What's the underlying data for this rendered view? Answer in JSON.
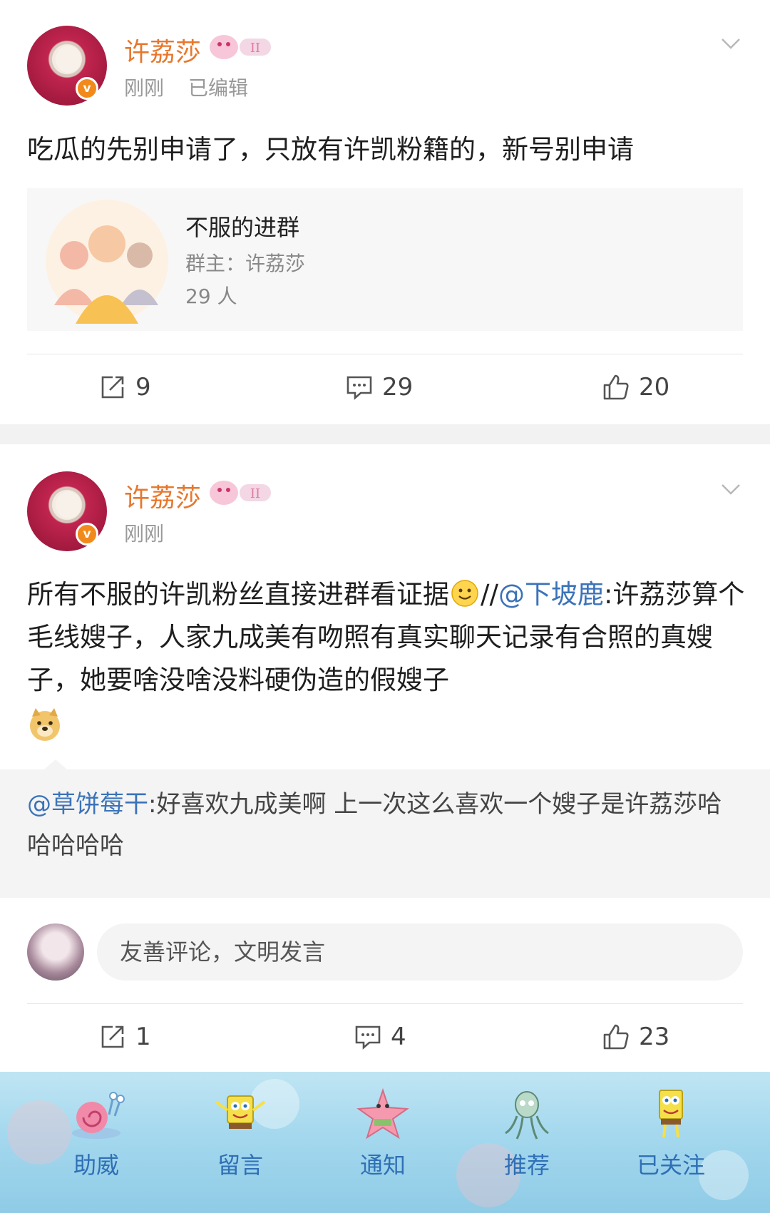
{
  "post1": {
    "username": "许荔莎",
    "time": "刚刚",
    "edited": "已编辑",
    "text": "吃瓜的先别申请了，只放有许凯粉籍的，新号别申请",
    "group_card": {
      "title": "不服的进群",
      "owner": "群主：许荔莎",
      "members": "29 人"
    },
    "actions": {
      "repost": "9",
      "comment": "29",
      "like": "20"
    }
  },
  "post2": {
    "username": "许荔莎",
    "time": "刚刚",
    "text_before_emoji": "所有不服的许凯粉丝直接进群看证据",
    "repost_prefix": "//",
    "mention": "@下坡鹿",
    "text_after_mention": ":许荔莎算个毛线嫂子，人家九成美有吻照有真实聊天记录有合照的真嫂子，她要啥没啥没料硬伪造的假嫂子",
    "quoted_comment": {
      "mention": "@草饼莓干",
      "text": ":好喜欢九成美啊 上一次这么喜欢一个嫂子是许荔莎哈哈哈哈哈"
    },
    "comment_input": {
      "placeholder": "友善评论，文明发言"
    },
    "actions": {
      "repost": "1",
      "comment": "4",
      "like": "23"
    }
  },
  "tabbar": {
    "items": [
      {
        "label": "助威",
        "icon": "snail-icon"
      },
      {
        "label": "留言",
        "icon": "sponge-icon"
      },
      {
        "label": "通知",
        "icon": "starfish-icon"
      },
      {
        "label": "推荐",
        "icon": "squid-icon"
      },
      {
        "label": "已关注",
        "icon": "sponge-standing-icon"
      }
    ]
  },
  "colors": {
    "username": "#e8772c",
    "mention": "#3b73b9",
    "tab_label": "#2f6fb5",
    "verified_badge": "#f28a1b"
  }
}
